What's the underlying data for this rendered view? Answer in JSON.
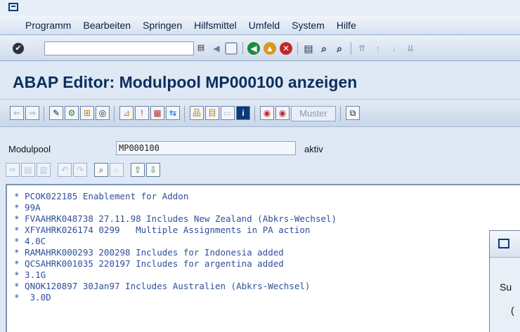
{
  "menubar": {
    "items": [
      "Programm",
      "Bearbeiten",
      "Springen",
      "Hilfsmittel",
      "Umfeld",
      "System",
      "Hilfe"
    ]
  },
  "systoolbar": {
    "command_field_value": ""
  },
  "screen": {
    "title": "ABAP Editor: Modulpool MP000100 anzeigen"
  },
  "apptoolbar": {
    "muster_label": "Muster"
  },
  "program": {
    "label": "Modulpool",
    "value": "MP000100",
    "status": "aktiv"
  },
  "editor": {
    "lines": [
      "* PCOK022185 Enablement for Addon",
      "* 99A",
      "* FVAAHRK048738 27.11.98 Includes New Zealand (Abkrs-Wechsel)",
      "* XFYAHRK026174 0299   Multiple Assignments in PA action",
      "* 4.0C",
      "* RAMAHRK000293 200298 Includes for Indonesia added",
      "* QCSAHRK001035 220197 Includes for argentina added",
      "* 3.1G",
      "* QNOK120897 30Jan97 Includes Australien (Abkrs-Wechsel)",
      "*  3.0D"
    ]
  },
  "popup": {
    "text": "Su",
    "paren": "("
  },
  "colors": {
    "title": "#0b2e5e",
    "comment_text": "#2f4f9a",
    "background": "#dfe9f5"
  }
}
